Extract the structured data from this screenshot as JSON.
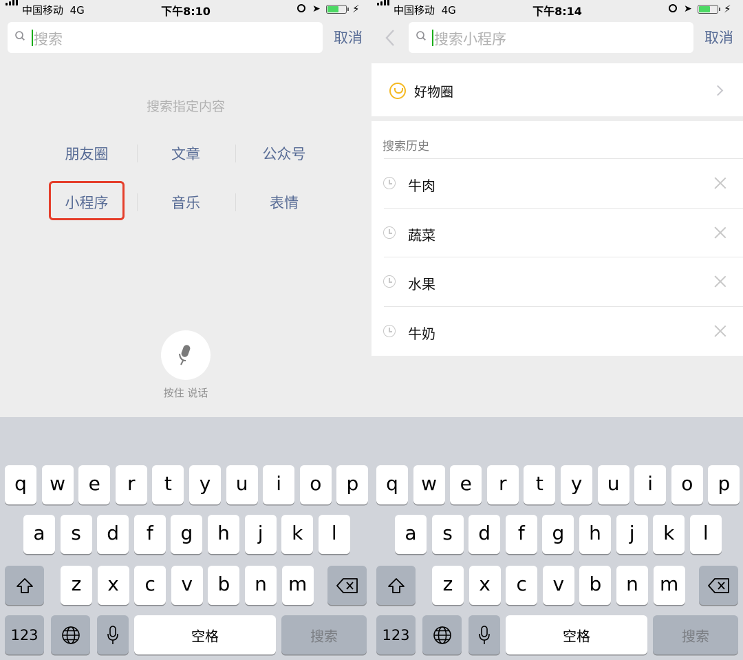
{
  "status_bar": {
    "left": {
      "carrier": "中国移动",
      "network": "4G",
      "time": "下午8:10"
    },
    "right": {
      "carrier": "中国移动",
      "network": "4G",
      "time": "下午8:14"
    },
    "battery_level": 0.6,
    "battery_color": "#4cd964"
  },
  "left_screen": {
    "search_placeholder": "搜索",
    "cancel_label": "取消",
    "hint": "搜索指定内容",
    "categories": [
      "朋友圈",
      "文章",
      "公众号",
      "小程序",
      "音乐",
      "表情"
    ],
    "highlighted_category": "小程序",
    "highlight_color": "#e53e2b",
    "voice_label": "按住 说话"
  },
  "right_screen": {
    "search_placeholder": "搜索小程序",
    "cancel_label": "取消",
    "featured": {
      "label": "好物圈",
      "icon": "smile-bag-icon"
    },
    "history_title": "搜索历史",
    "history": [
      "牛肉",
      "蔬菜",
      "水果",
      "牛奶"
    ]
  },
  "keyboard": {
    "row1": [
      "q",
      "w",
      "e",
      "r",
      "t",
      "y",
      "u",
      "i",
      "o",
      "p"
    ],
    "row2": [
      "a",
      "s",
      "d",
      "f",
      "g",
      "h",
      "j",
      "k",
      "l"
    ],
    "row3": [
      "z",
      "x",
      "c",
      "v",
      "b",
      "n",
      "m"
    ],
    "num_label": "123",
    "space_label": "空格",
    "search_label": "搜索",
    "icons": [
      "shift-icon",
      "backspace-icon",
      "globe-icon",
      "mic-icon"
    ]
  },
  "colors": {
    "accent": "#576b95",
    "cursor": "#1aad19",
    "page_bg": "#ededed",
    "keyboard_bg": "#d1d4da"
  }
}
